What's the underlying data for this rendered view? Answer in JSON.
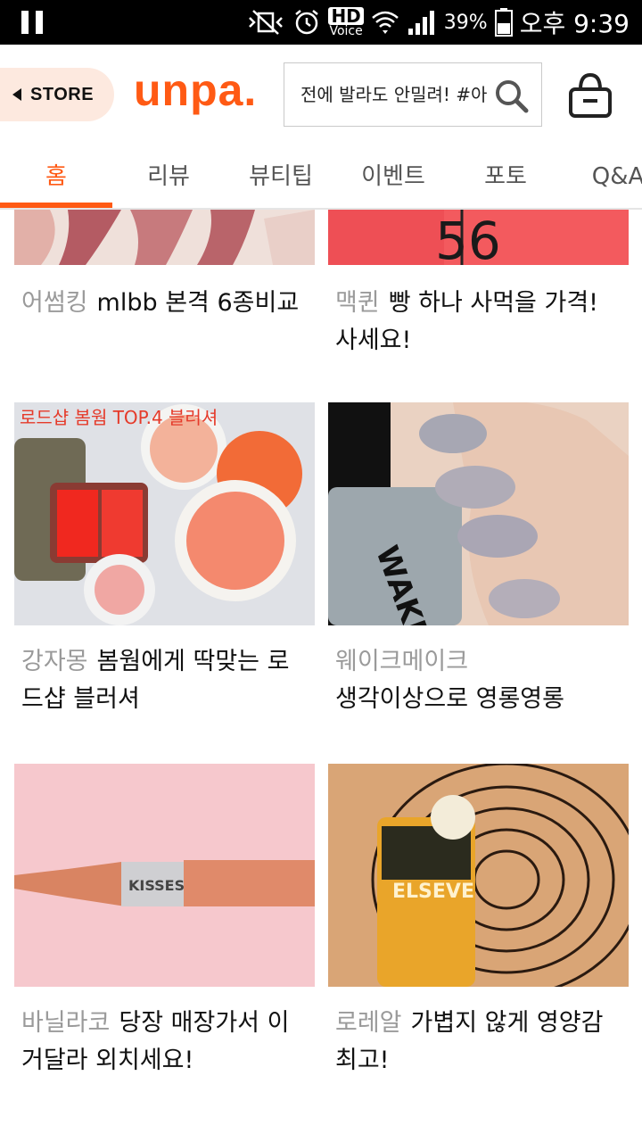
{
  "status_bar": {
    "battery": "39%",
    "time": "오후 9:39",
    "hd": "HD",
    "voice": "Voice"
  },
  "header": {
    "store_label": "STORE",
    "logo": "unpa.",
    "search_placeholder": "전에 발라도 안밀려! #아침"
  },
  "tabs": [
    "홈",
    "리뷰",
    "뷰티팁",
    "이벤트",
    "포토",
    "Q&A"
  ],
  "cards": [
    {
      "brand": "어썸킹",
      "title": "mlbb 본격 6종비교"
    },
    {
      "brand": "맥퀸",
      "title": "빵 하나 사먹을 가격! 사세요!",
      "image_text": "56"
    },
    {
      "brand": "강자몽",
      "title": "봄웜에게 딱맞는 로드샵 블러셔",
      "image_text": "로드샵 봄웜 TOP.4 블러셔"
    },
    {
      "brand": "웨이크메이크",
      "title": "생각이상으로 영롱영롱",
      "image_text": "WAKE MAKE"
    },
    {
      "brand": "바닐라코",
      "title": "당장 매장가서 이거달라 외치세요!",
      "image_text": "KISSES"
    },
    {
      "brand": "로레알",
      "title": "가볍지 않게 영양감 최고!",
      "image_text": "ELSEVE"
    }
  ]
}
